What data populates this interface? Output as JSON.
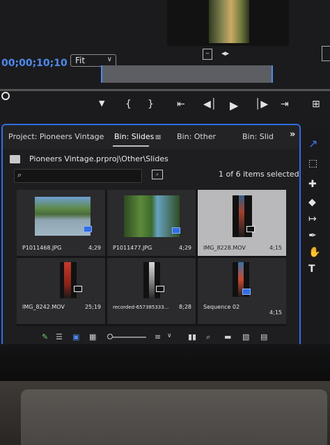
{
  "program_monitor": {
    "timecode": "00;00;10;10",
    "zoom": "Fit"
  },
  "project_panel": {
    "tabs": [
      {
        "label": "Project: Pioneers Vintage"
      },
      {
        "label": "Bin: Slides"
      },
      {
        "label": "Bin: Other"
      },
      {
        "label": "Bin: Slid"
      }
    ],
    "bin_path": "Pioneers Vintage.prproj\\Other\\Slides",
    "search_placeholder": "",
    "selection_status": "1 of 6 items selected",
    "items": [
      {
        "name": "P1011468.JPG",
        "duration": "4;29",
        "selected": false
      },
      {
        "name": "P1011477.JPG",
        "duration": "4;29",
        "selected": false
      },
      {
        "name": "IMG_8228.MOV",
        "duration": "4;15",
        "selected": true
      },
      {
        "name": "IMG_8242.MOV",
        "duration": "25;19",
        "selected": false
      },
      {
        "name": "recorded-657385333...",
        "duration": "8;28",
        "selected": false
      },
      {
        "name": "Sequence 02",
        "duration": "4;15",
        "selected": false
      }
    ]
  },
  "colors": {
    "accent": "#2f6ee6",
    "timecode": "#4b8bf0",
    "selected_tile": "#b9b9bb"
  },
  "icons": {
    "tools": [
      "selection-tool-icon",
      "track-select-tool-icon",
      "ripple-edit-tool-icon",
      "razor-tool-icon",
      "slip-tool-icon",
      "pen-tool-icon",
      "hand-tool-icon",
      "type-tool-icon"
    ]
  }
}
